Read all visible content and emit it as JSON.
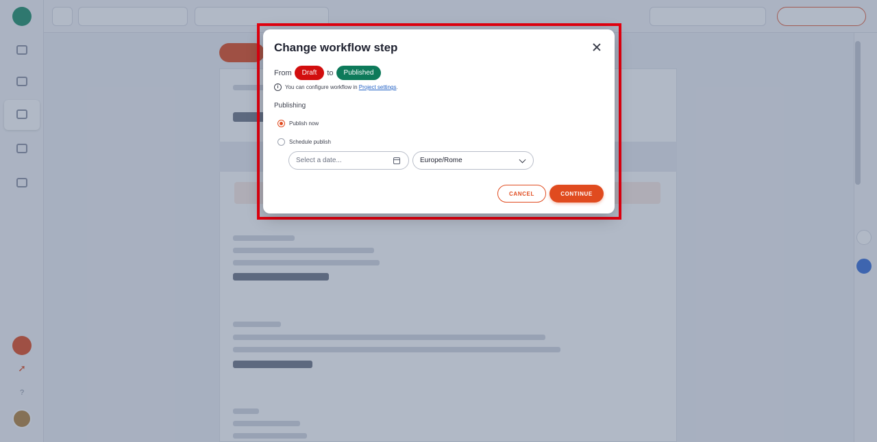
{
  "app": {
    "logo_letter": "",
    "nav_labels": [
      "",
      "",
      "",
      "",
      ""
    ],
    "topbar": {
      "back": "",
      "environment": "",
      "breadcrumb": "",
      "search_placeholder": "",
      "deploy_label": ""
    }
  },
  "modal": {
    "title": "Change workflow step",
    "from_label": "From",
    "from_status": "Draft",
    "to_label": "to",
    "to_status": "Published",
    "info_text": "You can configure workflow in ",
    "info_link": "Project settings",
    "info_suffix": ".",
    "section_label": "Publishing",
    "options": [
      {
        "label": "Publish now",
        "checked": true
      },
      {
        "label": "Schedule publish",
        "checked": false
      }
    ],
    "date_placeholder": "Select a date...",
    "timezone": "Europe/Rome",
    "cancel_label": "CANCEL",
    "continue_label": "CONTINUE"
  },
  "colors": {
    "accent": "#e04b1f",
    "draft": "#d20e0e",
    "published": "#0d7a5a",
    "highlight_border": "#e3000f",
    "link": "#1f5fc4"
  },
  "icons": {
    "close": "close-icon",
    "info": "info-icon",
    "calendar": "calendar-icon",
    "chevron": "chevron-down-icon"
  }
}
